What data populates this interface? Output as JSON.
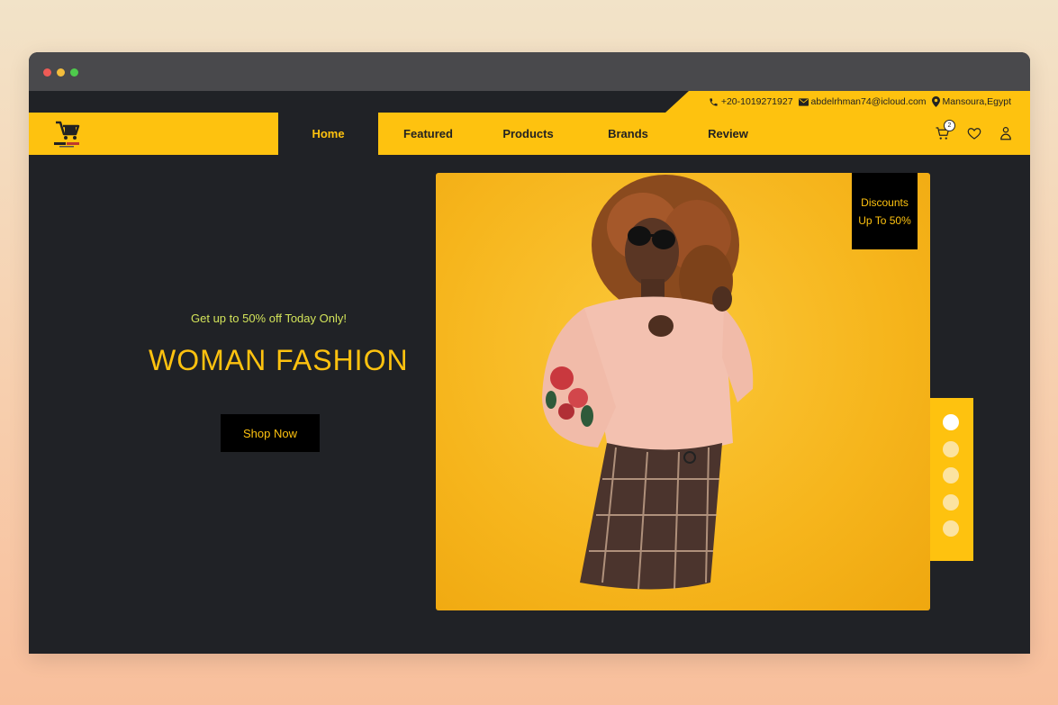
{
  "contact": {
    "phone": "+20-1019271927",
    "email": "abdelrhman74@icloud.com",
    "location": "Mansoura,Egypt"
  },
  "nav": {
    "items": [
      {
        "label": "Home",
        "active": true
      },
      {
        "label": "Featured",
        "active": false
      },
      {
        "label": "Products",
        "active": false
      },
      {
        "label": "Brands",
        "active": false
      },
      {
        "label": "Review",
        "active": false
      }
    ],
    "cart_count": "2"
  },
  "hero": {
    "tagline": "Get up to 50% off Today Only!",
    "headline": "WOMAN FASHION",
    "cta_label": "Shop Now",
    "discount_line1": "Discounts",
    "discount_line2": "Up To 50%"
  },
  "slider": {
    "count": 5,
    "active_index": 0
  },
  "icons": [
    "phone-icon",
    "mail-icon",
    "location-pin-icon",
    "cart-icon",
    "heart-icon",
    "user-icon"
  ],
  "colors": {
    "accent": "#fec20f",
    "background": "#202226",
    "tagline": "#d3e45a",
    "button": "#000000"
  }
}
